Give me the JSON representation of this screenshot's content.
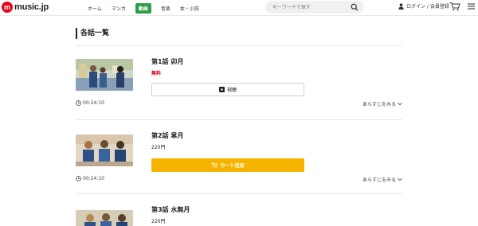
{
  "header": {
    "logo_badge": "m",
    "logo_text": "music.jp",
    "nav": [
      {
        "label": "ホーム",
        "active": false
      },
      {
        "label": "マンガ",
        "active": false
      },
      {
        "label": "動画",
        "active": true
      },
      {
        "label": "音楽",
        "active": false
      },
      {
        "label": "本・小説",
        "active": false
      }
    ],
    "search_placeholder": "キーワードで探す",
    "login_label": "ログイン / 会員登録",
    "accent_color": "#2e9d47",
    "brand_color": "#e0061a"
  },
  "section": {
    "title": "各話一覧"
  },
  "episodes": [
    {
      "title": "第1話 卯月",
      "price": "無料",
      "is_free": true,
      "button_label": "視聴",
      "button_icon": "play-icon",
      "duration": "00:24:10",
      "synopsis_label": "あらすじをみる"
    },
    {
      "title": "第2話 皐月",
      "price": "220円",
      "is_free": false,
      "button_label": "カート追加",
      "button_icon": "cart-icon",
      "duration": "00:24:10",
      "synopsis_label": "あらすじをみる"
    },
    {
      "title": "第3話 水無月",
      "price": "220円",
      "is_free": false
    }
  ],
  "colors": {
    "cart_button": "#f5b400",
    "free_price": "#d0021b"
  }
}
